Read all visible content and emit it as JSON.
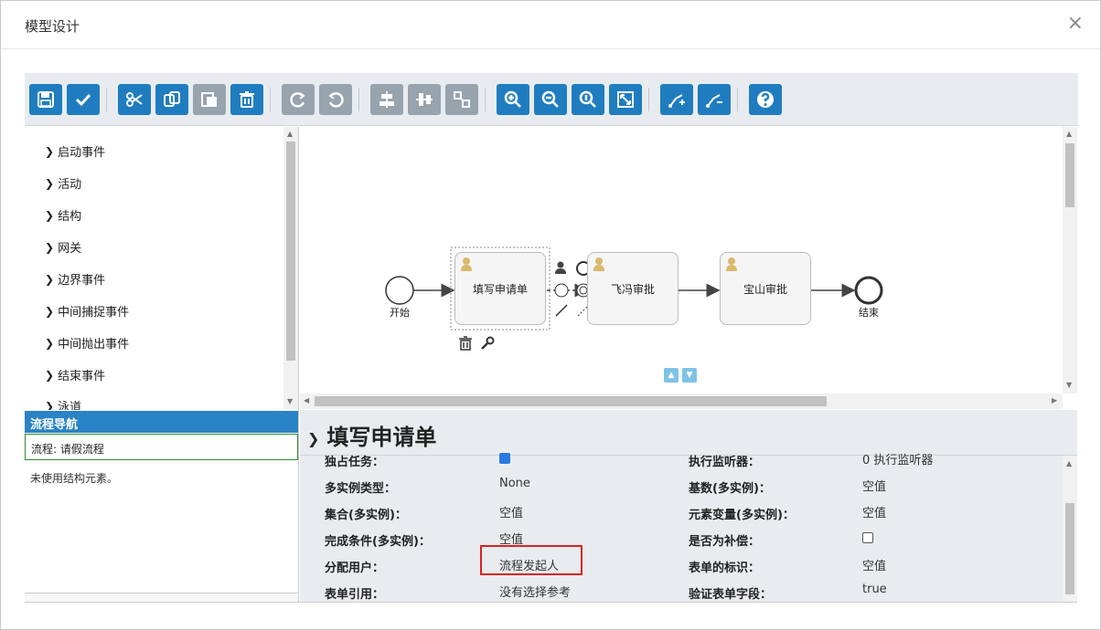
{
  "dialog": {
    "title": "模型设计",
    "close": "×"
  },
  "toolbar": {
    "buttons": [
      {
        "icon": "save-icon"
      },
      {
        "icon": "check-icon"
      },
      {
        "icon": "cut-icon"
      },
      {
        "icon": "copy-icon"
      },
      {
        "icon": "paste-icon"
      },
      {
        "icon": "delete-icon"
      },
      {
        "icon": "redo-icon"
      },
      {
        "icon": "undo-icon"
      },
      {
        "icon": "align-horizontal-icon"
      },
      {
        "icon": "align-vertical-icon"
      },
      {
        "icon": "same-size-icon"
      },
      {
        "icon": "zoom-in-icon"
      },
      {
        "icon": "zoom-out-icon"
      },
      {
        "icon": "zoom-actual-icon"
      },
      {
        "icon": "zoom-fit-icon"
      },
      {
        "icon": "add-bendpoint-icon"
      },
      {
        "icon": "remove-bendpoint-icon"
      },
      {
        "icon": "help-icon"
      }
    ]
  },
  "palette": {
    "items": [
      "启动事件",
      "活动",
      "结构",
      "网关",
      "边界事件",
      "中间捕捉事件",
      "中间抛出事件",
      "结束事件",
      "泳道"
    ]
  },
  "navigator": {
    "header": "流程导航",
    "item": "流程: 请假流程",
    "note": "未使用结构元素。"
  },
  "diagram": {
    "start_label": "开始",
    "end_label": "结束",
    "task1": "填写申请单",
    "task2": "飞冯审批",
    "task3": "宝山审批"
  },
  "properties": {
    "title": "填写申请单",
    "rows": [
      {
        "label": "独占任务：",
        "value": "",
        "check": true,
        "label2": "执行监听器：",
        "value2": "0 执行监听器"
      },
      {
        "label": "多实例类型：",
        "value": "None",
        "label2": "基数(多实例)：",
        "value2": "空值"
      },
      {
        "label": "集合(多实例)：",
        "value": "空值",
        "label2": "元素变量(多实例)：",
        "value2": "空值"
      },
      {
        "label": "完成条件(多实例)：",
        "value": "空值",
        "label2": "是否为补偿：",
        "value2": "",
        "check2": false
      },
      {
        "label": "分配用户：",
        "value": "流程发起人",
        "label2": "表单的标识：",
        "value2": "空值"
      },
      {
        "label": "表单引用：",
        "value": "没有选择参考",
        "label2": "验证表单字段：",
        "value2": "true"
      }
    ]
  },
  "colors": {
    "accent": "#1f7dbf",
    "nav_header": "#2a83c4",
    "highlight": "#e02020"
  }
}
